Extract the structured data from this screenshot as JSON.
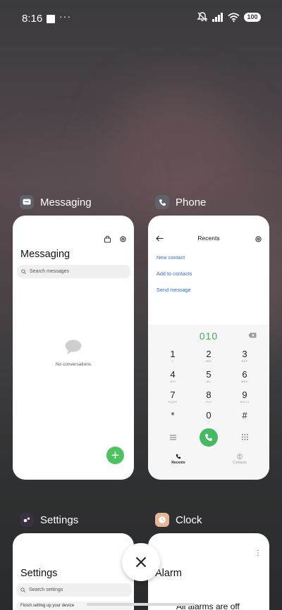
{
  "status_bar": {
    "time": "8:16",
    "more": "···",
    "battery": "100"
  },
  "cards": {
    "messaging": {
      "app_name": "Messaging",
      "title": "Messaging",
      "search_placeholder": "Search messages",
      "empty_text": "No conversations",
      "fab": "+"
    },
    "phone": {
      "app_name": "Phone",
      "title": "Recents",
      "links": [
        "New contact",
        "Add to contacts",
        "Send message"
      ],
      "dialed_number": "010",
      "keys": [
        {
          "digit": "1",
          "letters": "∞"
        },
        {
          "digit": "2",
          "letters": "ABC"
        },
        {
          "digit": "3",
          "letters": "DEF"
        },
        {
          "digit": "4",
          "letters": "GHI"
        },
        {
          "digit": "5",
          "letters": "JKL"
        },
        {
          "digit": "6",
          "letters": "MNO"
        },
        {
          "digit": "7",
          "letters": "PQRS"
        },
        {
          "digit": "8",
          "letters": "TUV"
        },
        {
          "digit": "9",
          "letters": "WXYZ"
        },
        {
          "digit": "*",
          "letters": ""
        },
        {
          "digit": "0",
          "letters": "+"
        },
        {
          "digit": "#",
          "letters": ""
        }
      ],
      "tab_recents": "Recents",
      "tab_contacts": "Contacts"
    },
    "settings": {
      "app_name": "Settings",
      "title": "Settings",
      "search_placeholder": "Search settings",
      "item": "Finish setting up your device"
    },
    "clock": {
      "app_name": "Clock",
      "title": "Alarm",
      "status": "All alarms are off"
    }
  },
  "colors": {
    "accent_green": "#4cc35f",
    "link_blue": "#2f6fd6"
  }
}
